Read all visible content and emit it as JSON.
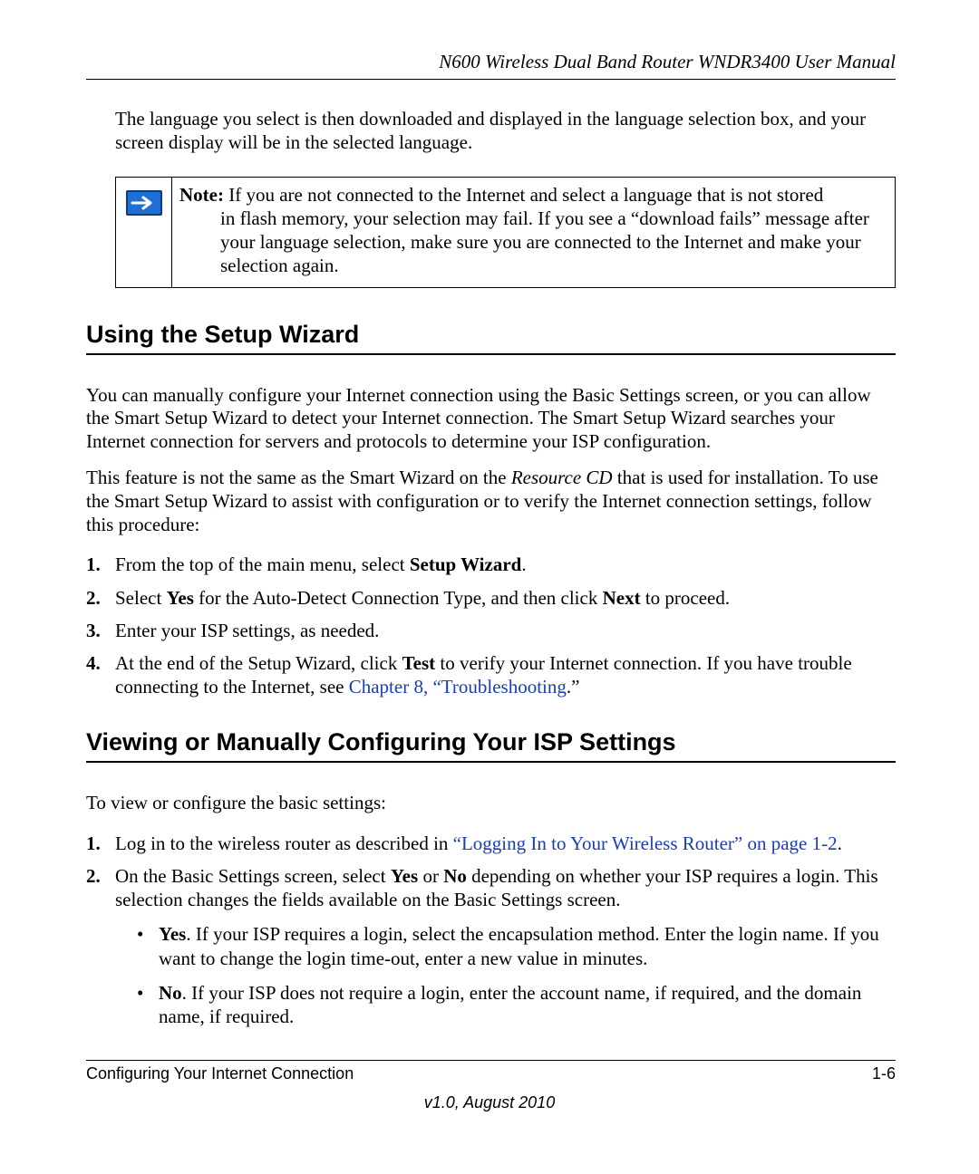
{
  "header": {
    "title": "N600 Wireless Dual Band Router WNDR3400 User Manual"
  },
  "intro": "The language you select is then downloaded and displayed in the language selection box, and your screen display will be in the selected language.",
  "note": {
    "label": "Note:",
    "line1": " If you are not connected to the Internet and select a language that is not stored",
    "rest": "in flash memory, your selection may fail. If you see a “download fails” message after your language selection, make sure you are connected to the Internet and make your selection again."
  },
  "section1": {
    "heading": "Using the Setup Wizard",
    "para1": "You can manually configure your Internet connection using the Basic Settings screen, or you can allow the Smart Setup Wizard to detect your Internet connection. The Smart Setup Wizard searches your Internet connection for servers and protocols to determine your ISP configuration.",
    "para2_a": "This feature is not the same as the Smart Wizard on the ",
    "para2_em": "Resource CD",
    "para2_b": " that is used for installation. To use the Smart Setup Wizard to assist with configuration or to verify the Internet connection settings, follow this procedure:",
    "steps": {
      "s1_a": "From the top of the main menu, select ",
      "s1_b": "Setup Wizard",
      "s1_c": ".",
      "s2_a": "Select ",
      "s2_b": "Yes",
      "s2_c": " for the Auto-Detect Connection Type, and then click ",
      "s2_d": "Next",
      "s2_e": " to proceed.",
      "s3": "Enter your ISP settings, as needed.",
      "s4_a": "At the end of the Setup Wizard, click ",
      "s4_b": "Test",
      "s4_c": " to verify your Internet connection. If you have trouble connecting to the Internet, see ",
      "s4_link": "Chapter 8, “Troubleshooting",
      "s4_d": ".”"
    }
  },
  "section2": {
    "heading": "Viewing or Manually Configuring Your ISP Settings",
    "para1": "To view or configure the basic settings:",
    "steps": {
      "s1_a": "Log in to the wireless router as described in ",
      "s1_link": "“Logging In to Your Wireless Router” on page 1-2",
      "s1_b": ".",
      "s2_a": "On the Basic Settings screen, select ",
      "s2_b": "Yes",
      "s2_c": " or ",
      "s2_d": "No",
      "s2_e": " depending on whether your ISP requires a login. This selection changes the fields available on the Basic Settings screen.",
      "sub_yes_b": "Yes",
      "sub_yes_t": ". If your ISP requires a login, select the encapsulation method. Enter the login name. If you want to change the login time-out, enter a new value in minutes.",
      "sub_no_b": "No",
      "sub_no_t": ". If your ISP does not require a login, enter the account name, if required, and the domain name, if required."
    }
  },
  "footer": {
    "left": "Configuring Your Internet Connection",
    "right": "1-6",
    "version": "v1.0, August 2010"
  }
}
